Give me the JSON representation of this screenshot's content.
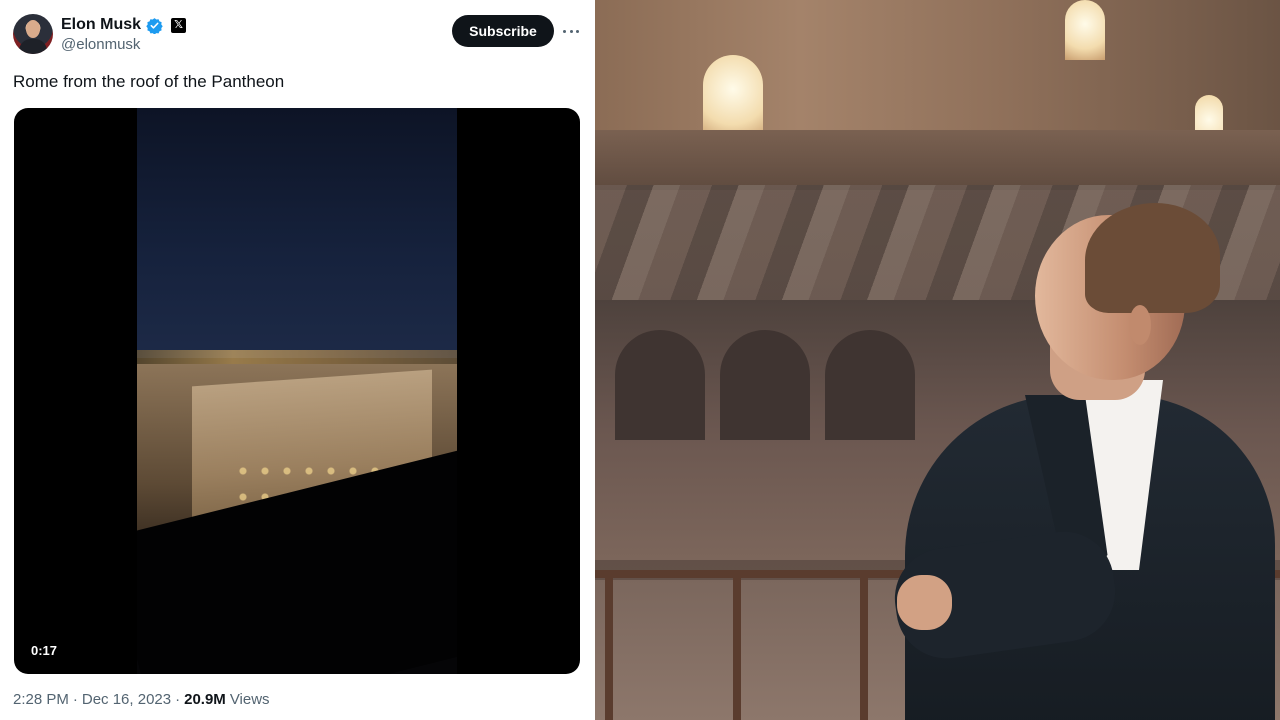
{
  "tweet": {
    "author": {
      "display_name": "Elon Musk",
      "handle": "@elonmusk",
      "verified_icon": "verified-badge-icon",
      "affiliation_badge": "𝕏"
    },
    "subscribe_label": "Subscribe",
    "more_icon": "more-options-icon",
    "text": "Rome from the roof of the Pantheon",
    "media": {
      "type": "video",
      "duration": "0:17"
    },
    "time": "2:28 PM",
    "separator": "·",
    "date": "Dec 16, 2023",
    "views_count": "20.9M",
    "views_label": "Views"
  },
  "colors": {
    "text_primary": "#0f1419",
    "text_secondary": "#536471",
    "verified_blue": "#1d9bf0",
    "button_dark": "#0f1419"
  }
}
